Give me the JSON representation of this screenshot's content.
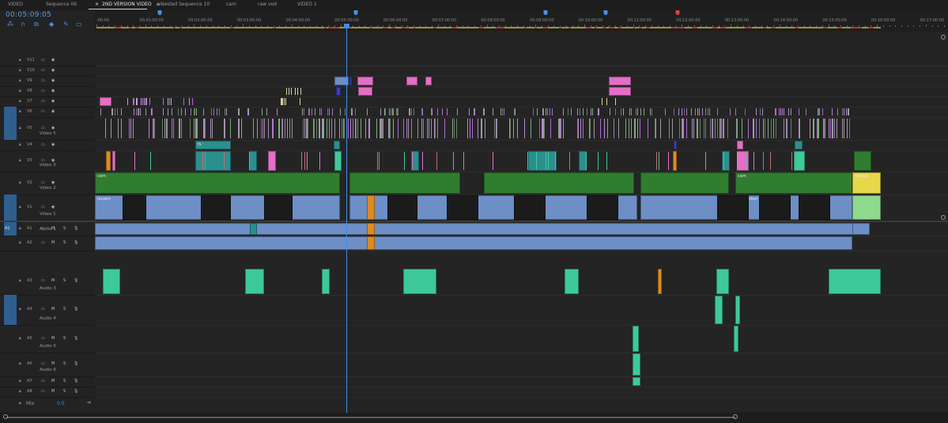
{
  "tabs": [
    {
      "label": "VIDEO",
      "active": false
    },
    {
      "label": "Sequence 06",
      "active": false
    },
    {
      "label": "2ND VERSION VIDEO",
      "active": true,
      "close": "×",
      "menu": "≡"
    },
    {
      "label": "Nested Sequence 10",
      "active": false
    },
    {
      "label": "cam",
      "active": false
    },
    {
      "label": "raw vod",
      "active": false
    },
    {
      "label": "VIDEO 1",
      "active": false
    }
  ],
  "timecode": "00:05:09:05",
  "toolbar": [
    {
      "name": "nest-toggle-icon",
      "glyph": "⁂"
    },
    {
      "name": "snap-icon",
      "glyph": "∩"
    },
    {
      "name": "linked-selection-icon",
      "glyph": "⧉"
    },
    {
      "name": "add-marker-icon",
      "glyph": "◆"
    },
    {
      "name": "wrench-icon",
      "glyph": "✎"
    },
    {
      "name": "captions-icon",
      "glyph": "▭"
    }
  ],
  "ruler": {
    "ticks": [
      ":00:00",
      "00:01:00:00",
      "00:02:00:00",
      "00:03:00:00",
      "00:04:00:00",
      "00:05:00:00",
      "00:06:00:00",
      "00:07:00:00",
      "00:08:00:00",
      "00:09:00:00",
      "00:10:00:00",
      "00:11:00:00",
      "00:12:00:00",
      "00:13:00:00",
      "00:14:00:00",
      "00:15:00:00",
      "00:16:00:00",
      "00:17:00:00"
    ],
    "markers": [
      {
        "frac": 0.076,
        "color": "#4a90e2"
      },
      {
        "frac": 0.306,
        "color": "#4a90e2"
      },
      {
        "frac": 0.528,
        "color": "#4a90e2"
      },
      {
        "frac": 0.599,
        "color": "#4a90e2"
      },
      {
        "frac": 0.683,
        "color": "#e04040"
      }
    ]
  },
  "video_tracks": [
    {
      "id": "V11",
      "name": ""
    },
    {
      "id": "V10",
      "name": ""
    },
    {
      "id": "V9",
      "name": ""
    },
    {
      "id": "V8",
      "name": ""
    },
    {
      "id": "V7",
      "name": ""
    },
    {
      "id": "V6",
      "name": ""
    },
    {
      "id": "V5",
      "name": "Video 5"
    },
    {
      "id": "V4",
      "name": ""
    },
    {
      "id": "V3",
      "name": "Video 3"
    },
    {
      "id": "V2",
      "name": "Video 2"
    },
    {
      "id": "V1",
      "name": "Video 1"
    }
  ],
  "audio_tracks": [
    {
      "id": "A1",
      "name": "Audio 1",
      "source": "A1"
    },
    {
      "id": "A2",
      "name": "",
      "source": ""
    },
    {
      "id": "A3",
      "name": "Audio 3",
      "source": ""
    },
    {
      "id": "A4",
      "name": "Audio 4",
      "source": ""
    },
    {
      "id": "A5",
      "name": "Audio 5",
      "source": ""
    },
    {
      "id": "A6",
      "name": "Audio 6",
      "source": ""
    },
    {
      "id": "A7",
      "name": "",
      "source": ""
    },
    {
      "id": "A8",
      "name": "",
      "source": ""
    }
  ],
  "mix": {
    "label": "Mix",
    "value": "0.0"
  },
  "clip_labels": {
    "cam": "cam",
    "novem": "novem",
    "november": "november",
    "november1": "november 1",
    "outrea": "outrea",
    "fx": "fx"
  },
  "colors": {
    "accent": "#4a90e2",
    "green": "#2f7d2f",
    "blue_clip": "#6d8fc6",
    "teal": "#2b8f8f",
    "mint": "#3ec99a",
    "violet": "#b06ad8",
    "pink": "#e46fc7",
    "orange": "#e08a1e",
    "playhead": "#3f8fe8"
  }
}
